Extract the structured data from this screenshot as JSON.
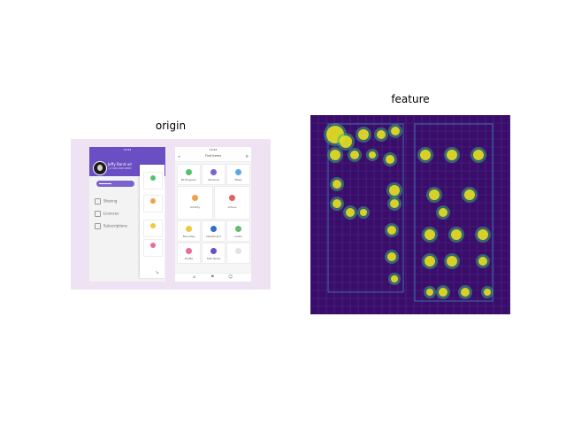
{
  "titles": {
    "origin": "origin",
    "feature": "feature"
  },
  "colors": {
    "header_purple": "#6a4fc4",
    "panel_bg": "#efe3f3",
    "feature_bg": "#3b0d6a",
    "feature_hot": "#f3e51a",
    "feature_mid": "#35b778"
  },
  "origin": {
    "phone1": {
      "status_time": "10:24",
      "profile_name": "Jeffy Band ud",
      "profile_sub": "+1 000 000 0000",
      "menu": [
        {
          "icon": "share-icon",
          "label": "Sharing"
        },
        {
          "icon": "lock-icon",
          "label": "Licences"
        },
        {
          "icon": "clock-icon",
          "label": "Subscriptions"
        }
      ]
    },
    "phone2": {
      "status_time": "10:24",
      "title": "Find Items",
      "tiles": [
        {
          "label": "Fit Program",
          "color": "#55c06e"
        },
        {
          "label": "Workout",
          "color": "#7b63cf"
        },
        {
          "label": "Maps",
          "color": "#5aa7e6"
        },
        {
          "label": "Activity",
          "color": "#f0a048"
        },
        {
          "label": "Videos",
          "color": "#e85d5d"
        },
        {
          "label": "Favorites",
          "color": "#f1c740"
        },
        {
          "label": "Dashboard",
          "color": "#2f6fcb"
        },
        {
          "label": "Goals",
          "color": "#5fbf73"
        },
        {
          "label": "Profile",
          "color": "#e96d96"
        },
        {
          "label": "SOS Items",
          "color": "#6a4fc4"
        },
        {
          "label": "",
          "color": "#e2e2e2"
        }
      ]
    }
  }
}
